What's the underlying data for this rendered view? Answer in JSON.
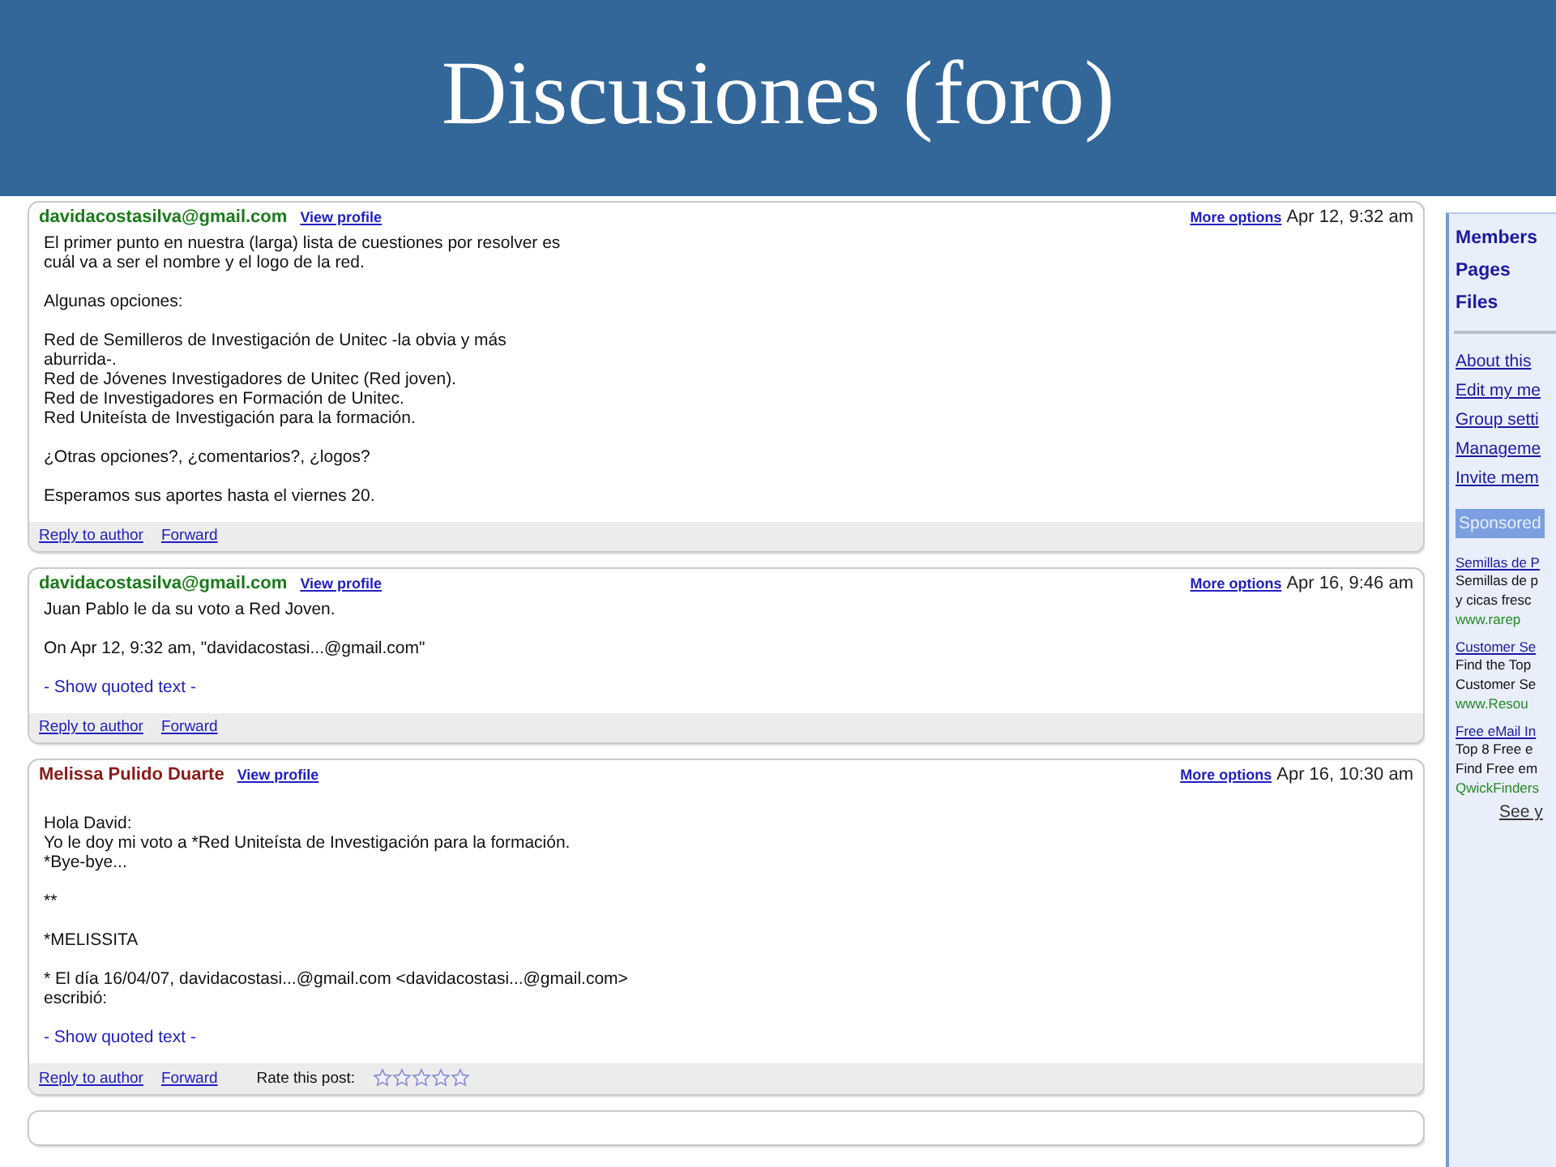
{
  "slide_title": "Discusiones (foro)",
  "posts": [
    {
      "author": "davidacostasilva@gmail.com",
      "kind": "email",
      "view_profile": "View profile",
      "more_options": "More options",
      "date": "Apr 12, 9:32 am",
      "paragraphs": [
        "El primer punto en nuestra (larga) lista de cuestiones por resolver es\ncuál va a ser el nombre y el logo de la red.",
        "Algunas opciones:",
        "Red de Semilleros de Investigación de Unitec -la obvia y más\naburrida-.\nRed de Jóvenes Investigadores de Unitec (Red joven).\nRed de Investigadores en Formación de Unitec.\nRed Uniteísta de Investigación para la formación.",
        "¿Otras opciones?, ¿comentarios?, ¿logos?",
        "Esperamos sus aportes hasta el viernes 20."
      ],
      "actions": [
        "Reply to author",
        "Forward"
      ]
    },
    {
      "author": "davidacostasilva@gmail.com",
      "kind": "email",
      "view_profile": "View profile",
      "more_options": "More options",
      "date": "Apr 16, 9:46 am",
      "paragraphs": [
        "Juan Pablo le da su voto a Red Joven.",
        "On Apr 12, 9:32 am, \"davidacostasi...@gmail.com\""
      ],
      "show_quoted": "- Show quoted text -",
      "actions": [
        "Reply to author",
        "Forward"
      ]
    },
    {
      "author": "Melissa Pulido Duarte",
      "kind": "name",
      "view_profile": "View profile",
      "more_options": "More options",
      "date": "Apr 16, 10:30 am",
      "paragraphs": [
        "Hola David:\nYo le doy mi voto a *Red Uniteísta de Investigación para la formación.\n*Bye-bye...",
        "**",
        "*MELISSITA",
        "* El día 16/04/07, davidacostasi...@gmail.com <davidacostasi...@gmail.com>\nescribió:"
      ],
      "show_quoted": "- Show quoted text -",
      "actions": [
        "Reply to author",
        "Forward"
      ],
      "rating": {
        "label": "Rate this post:",
        "stars": 0
      }
    }
  ],
  "sidebar": {
    "nav": [
      "Members",
      "Pages",
      "Files"
    ],
    "links": [
      "About this",
      "Edit my me",
      "Group setti",
      "Manageme",
      "Invite mem"
    ],
    "sponsored": "Sponsored",
    "ads": [
      {
        "title": "Semillas de P",
        "lines": [
          "Semillas de p",
          "y cicas fresc"
        ],
        "url": "www.rarep"
      },
      {
        "title": "Customer Se",
        "lines": [
          "Find the Top",
          "Customer Se"
        ],
        "url": "www.Resou"
      },
      {
        "title": "Free eMail In",
        "lines": [
          "Top 8 Free e",
          "Find Free em"
        ],
        "url": "QwickFinders"
      }
    ],
    "see_more": "See y"
  }
}
